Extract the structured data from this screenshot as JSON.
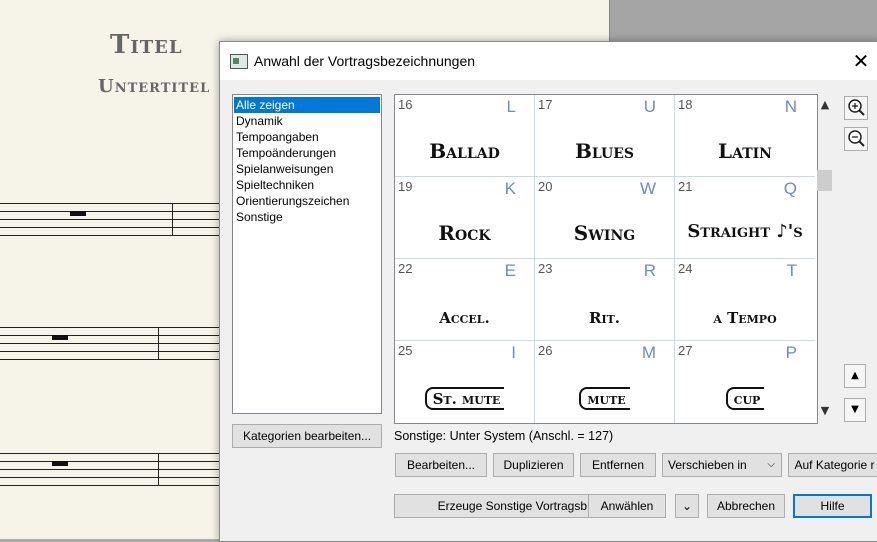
{
  "score": {
    "title": "Titel",
    "subtitle": "Untertitel"
  },
  "dialog": {
    "title": "Anwahl der Vortragsbezeichnungen",
    "close_glyph": "✕",
    "categories": [
      "Alle zeigen",
      "Dynamik",
      "Tempoangaben",
      "Tempoänderungen",
      "Spielanweisungen",
      "Spieltechniken",
      "Orientierungszeichen",
      "Sonstige"
    ],
    "selected_category": "Alle zeigen",
    "edit_categories_label": "Kategorien bearbeiten...",
    "grid": [
      {
        "num": "16",
        "key": "L",
        "text": "Ballad"
      },
      {
        "num": "17",
        "key": "U",
        "text": "Blues"
      },
      {
        "num": "18",
        "key": "N",
        "text": "Latin"
      },
      {
        "num": "19",
        "key": "K",
        "text": "Rock"
      },
      {
        "num": "20",
        "key": "W",
        "text": "Swing"
      },
      {
        "num": "21",
        "key": "Q",
        "text": "Straight ♪'s"
      },
      {
        "num": "22",
        "key": "E",
        "text": "Accel."
      },
      {
        "num": "23",
        "key": "R",
        "text": "Rit."
      },
      {
        "num": "24",
        "key": "T",
        "text": "a Tempo"
      },
      {
        "num": "25",
        "key": "I",
        "text": "St. mute"
      },
      {
        "num": "26",
        "key": "M",
        "text": "mute"
      },
      {
        "num": "27",
        "key": "P",
        "text": "cup"
      }
    ],
    "status": "Sonstige: Unter System (Anschl. = 127)",
    "buttons": {
      "edit": "Bearbeiten...",
      "duplicate": "Duplizieren",
      "remove": "Entfernen",
      "move_to": "Verschieben in",
      "to_category": "Auf Kategorie r",
      "create": "Erzeuge Sonstige Vortragsb",
      "select": "Anwählen",
      "cancel": "Abbrechen",
      "help": "Hilfe"
    },
    "icons": {
      "zoom_in": "zoom-in-icon",
      "zoom_out": "zoom-out-icon",
      "scroll_up": "▲",
      "scroll_down": "▼",
      "chevron": "⌄"
    }
  }
}
